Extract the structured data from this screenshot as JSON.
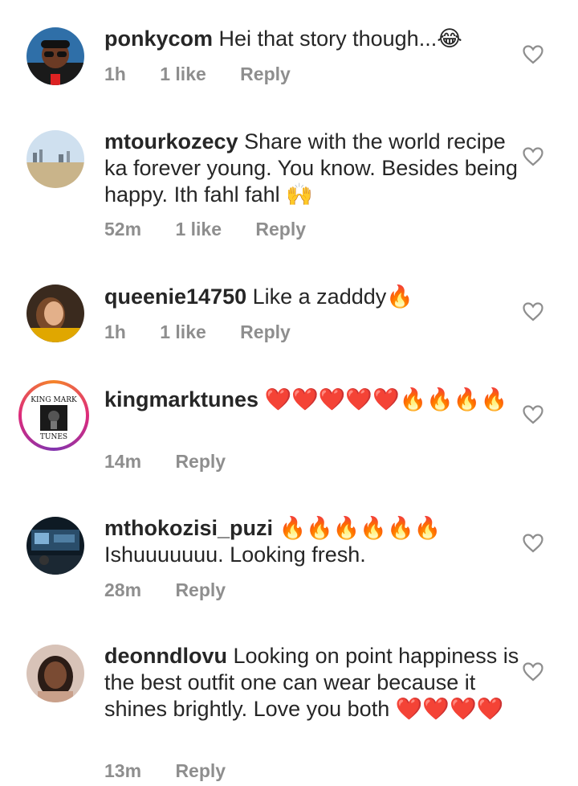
{
  "comments": [
    {
      "username": "ponkycom",
      "text": "Hei that story though...",
      "emoji_after": "😂",
      "time": "1h",
      "likes": "1 like",
      "reply": "Reply",
      "avatar_icon": "avatar-man-cap"
    },
    {
      "username": "mtourkozecy",
      "text": "Share with the world recipe ka forever young. You  know. Besides being happy. Ith  fahl fahl",
      "emoji_after": "🙌",
      "time": "52m",
      "likes": "1 like",
      "reply": "Reply",
      "avatar_icon": "avatar-beach"
    },
    {
      "username": "queenie14750",
      "text": "Like a zadddy",
      "emoji_after": "🔥",
      "time": "1h",
      "likes": "1 like",
      "reply": "Reply",
      "avatar_icon": "avatar-woman"
    },
    {
      "username": "kingmarktunes",
      "text": "",
      "emoji_after": "❤️❤️❤️❤️❤️🔥🔥🔥🔥",
      "time": "14m",
      "likes": "",
      "reply": "Reply",
      "avatar_icon": "avatar-logo",
      "avatar_text_top": "KING MARK",
      "avatar_text_bottom": "TUNES"
    },
    {
      "username": "mthokozisi_puzi",
      "text": "Ishuuuuuuu. Looking fresh.",
      "emoji_after": "🔥🔥🔥🔥🔥🔥",
      "time": "28m",
      "likes": "",
      "reply": "Reply",
      "avatar_icon": "avatar-studio"
    },
    {
      "username": "deonndlovu",
      "text": "Looking on  point happiness is the best outfit one can wear because it shines brightly. Love you both",
      "emoji_after": "❤️❤️❤️❤️",
      "time": "13m",
      "likes": "",
      "reply": "Reply",
      "avatar_icon": "avatar-woman-2"
    }
  ],
  "colors": {
    "text": "#262626",
    "meta": "#8e8e8e",
    "heart_outline": "#8e8e8e",
    "emoji_heart": "#e0202a",
    "emoji_fire": "#f39c12"
  }
}
